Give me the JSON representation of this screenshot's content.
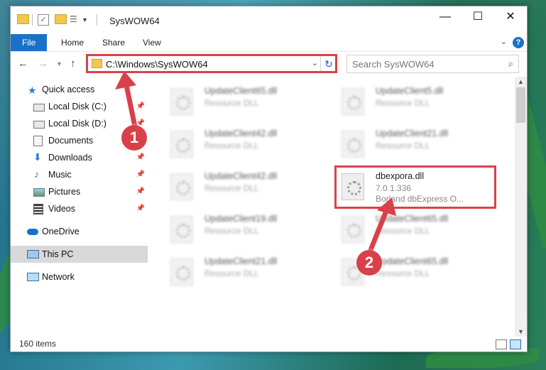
{
  "window": {
    "title": "SysWOW64",
    "minimize_glyph": "—",
    "maximize_glyph": "☐",
    "close_glyph": "✕"
  },
  "ribbon": {
    "tabs": [
      "File",
      "Home",
      "Share",
      "View"
    ],
    "help_glyph": "?"
  },
  "address": {
    "path": "C:\\Windows\\SysWOW64",
    "search_placeholder": "Search SysWOW64"
  },
  "sidebar": {
    "items": [
      {
        "label": "Quick access",
        "icon": "star-icon",
        "pinned": false
      },
      {
        "label": "Local Disk (C:)",
        "icon": "drive-icon",
        "pinned": true
      },
      {
        "label": "Local Disk (D:)",
        "icon": "drive-icon",
        "pinned": true
      },
      {
        "label": "Documents",
        "icon": "documents-icon",
        "pinned": true
      },
      {
        "label": "Downloads",
        "icon": "download-icon",
        "pinned": true
      },
      {
        "label": "Music",
        "icon": "music-icon",
        "pinned": true
      },
      {
        "label": "Pictures",
        "icon": "pictures-icon",
        "pinned": true
      },
      {
        "label": "Videos",
        "icon": "videos-icon",
        "pinned": true
      },
      {
        "label": "OneDrive",
        "icon": "cloud-icon",
        "pinned": false
      },
      {
        "label": "This PC",
        "icon": "computer-icon",
        "pinned": false,
        "selected": true
      },
      {
        "label": "Network",
        "icon": "network-icon",
        "pinned": false
      }
    ]
  },
  "files": [
    {
      "name": "UpdateClient65.dll",
      "line1": "Resource DLL",
      "line2": "",
      "blurred": true
    },
    {
      "name": "UpdateClient5.dll",
      "line1": "Resource DLL",
      "line2": "",
      "blurred": true
    },
    {
      "name": "UpdateClient42.dll",
      "line1": "Resource DLL",
      "line2": "",
      "blurred": true
    },
    {
      "name": "UpdateClient21.dll",
      "line1": "Resource DLL",
      "line2": "",
      "blurred": true
    },
    {
      "name": "UpdateClient42.dll",
      "line1": "Resource DLL",
      "line2": "",
      "blurred": true
    },
    {
      "name": "dbexpora.dll",
      "line1": "7.0.1.336",
      "line2": "Borland dbExpress O...",
      "blurred": false
    },
    {
      "name": "UpdateClient19.dll",
      "line1": "Resource DLL",
      "line2": "",
      "blurred": true
    },
    {
      "name": "UpdateClient65.dll",
      "line1": "Resource DLL",
      "line2": "",
      "blurred": true
    },
    {
      "name": "UpdateClient21.dll",
      "line1": "Resource DLL",
      "line2": "",
      "blurred": true
    },
    {
      "name": "UpdateClient65.dll",
      "line1": "Resource DLL",
      "line2": "",
      "blurred": true
    }
  ],
  "status": {
    "item_count": "160 items"
  },
  "callouts": [
    "1",
    "2"
  ],
  "colors": {
    "accent": "#1a72c8",
    "highlight": "#d9414a"
  }
}
